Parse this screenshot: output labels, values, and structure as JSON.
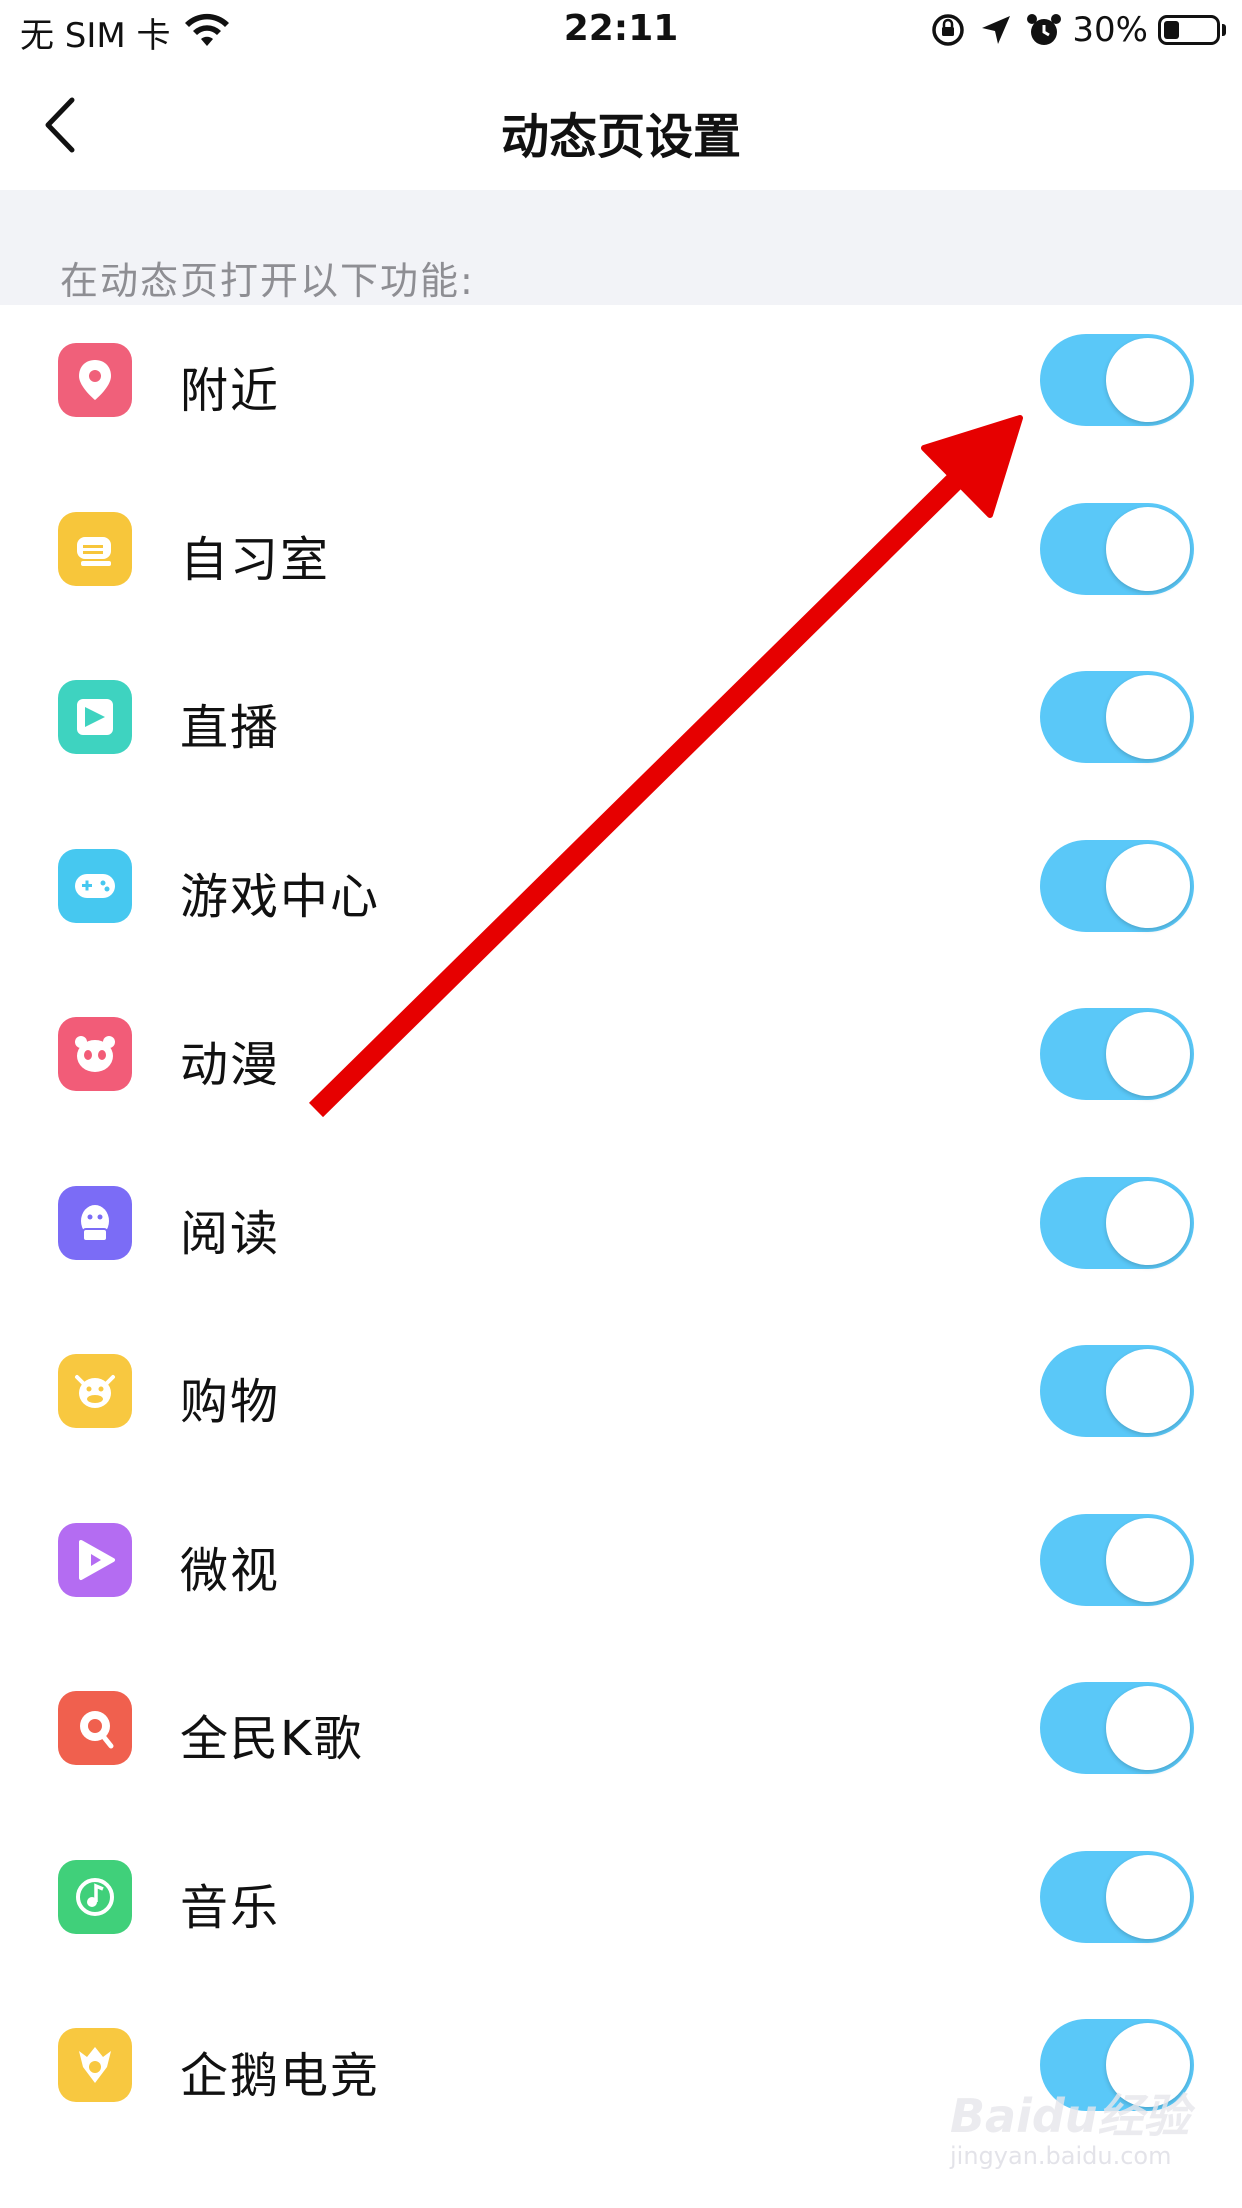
{
  "status_bar": {
    "carrier": "无 SIM 卡",
    "time": "22:11",
    "battery_percent": "30%",
    "battery_level": 0.3,
    "icons": [
      "wifi-icon",
      "rotation-lock-icon",
      "location-icon",
      "alarm-icon",
      "battery-icon"
    ]
  },
  "nav": {
    "back_icon": "chevron-left-icon",
    "title": "动态页设置"
  },
  "section": {
    "header": "在动态页打开以下功能:"
  },
  "rows": [
    {
      "label": "附近",
      "icon": "location-pin-icon",
      "color": "#f0607a",
      "enabled": true
    },
    {
      "label": "自习室",
      "icon": "study-room-icon",
      "color": "#f7c63b",
      "enabled": true
    },
    {
      "label": "直播",
      "icon": "live-icon",
      "color": "#3ed3c0",
      "enabled": true
    },
    {
      "label": "游戏中心",
      "icon": "gamepad-icon",
      "color": "#46c8f0",
      "enabled": true
    },
    {
      "label": "动漫",
      "icon": "panda-icon",
      "color": "#f25c78",
      "enabled": true
    },
    {
      "label": "阅读",
      "icon": "penguin-reading-icon",
      "color": "#7b6cf6",
      "enabled": true
    },
    {
      "label": "购物",
      "icon": "cow-icon",
      "color": "#f8c840",
      "enabled": true
    },
    {
      "label": "微视",
      "icon": "play-icon",
      "color": "#b46cf2",
      "enabled": true
    },
    {
      "label": "全民K歌",
      "icon": "karaoke-icon",
      "color": "#f0604e",
      "enabled": true
    },
    {
      "label": "音乐",
      "icon": "music-icon",
      "color": "#40d07a",
      "enabled": true
    },
    {
      "label": "企鹅电竞",
      "icon": "esports-icon",
      "color": "#f8c840",
      "enabled": true
    }
  ],
  "colors": {
    "toggle_on": "#5ac8f8",
    "annotation": "#e60000",
    "section_bg": "#f2f3f7"
  },
  "watermark": {
    "brand": "Baidu经验",
    "sub": "jingyan.baidu.com"
  }
}
